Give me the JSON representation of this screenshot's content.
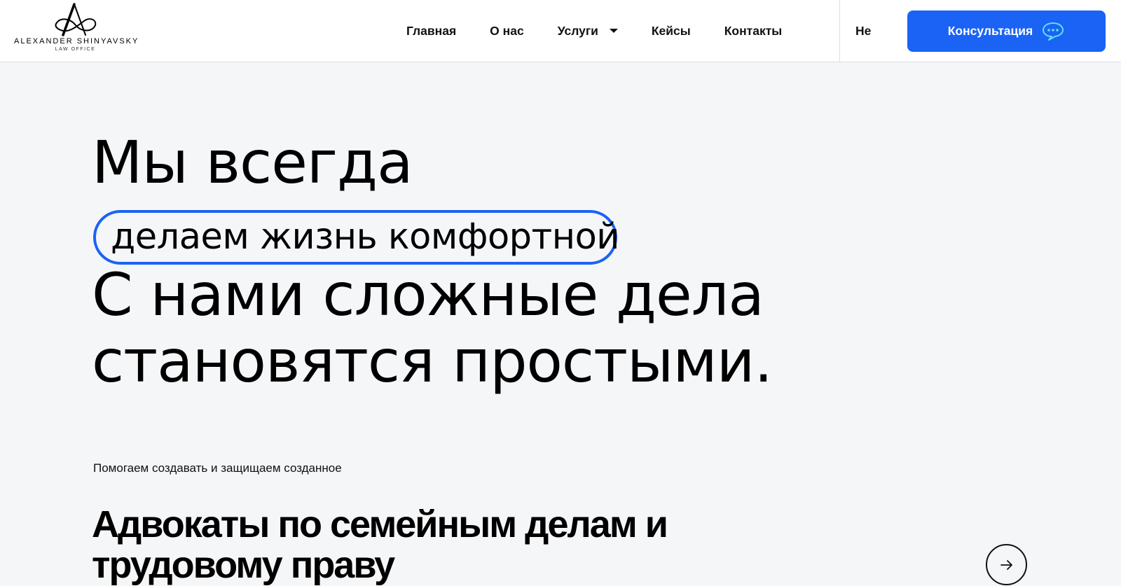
{
  "header": {
    "logo": {
      "name": "ALEXANDER SHINYAVSKY",
      "subtitle": "LAW OFFICE"
    },
    "nav": [
      {
        "label": "Главная"
      },
      {
        "label": "О нас"
      },
      {
        "label": "Услуги",
        "has_dropdown": true
      },
      {
        "label": "Кейсы"
      },
      {
        "label": "Контакты"
      }
    ],
    "language": "Не",
    "cta": {
      "label": "Консультация",
      "icon": "chat-bubble-icon",
      "color": "#1b63f5",
      "icon_color": "#5fe0f5"
    }
  },
  "hero": {
    "line1": "Мы всегда",
    "highlight": "делаем жизнь комфортной",
    "line3": "С нами сложные дела",
    "line4": "становятся простыми.",
    "accent_color": "#1b63f5"
  },
  "tagline": "Помогаем создавать и защищаем созданное",
  "section": {
    "title": "Адвокаты по семейным делам и трудовому праву",
    "arrow_icon": "arrow-right-icon"
  }
}
